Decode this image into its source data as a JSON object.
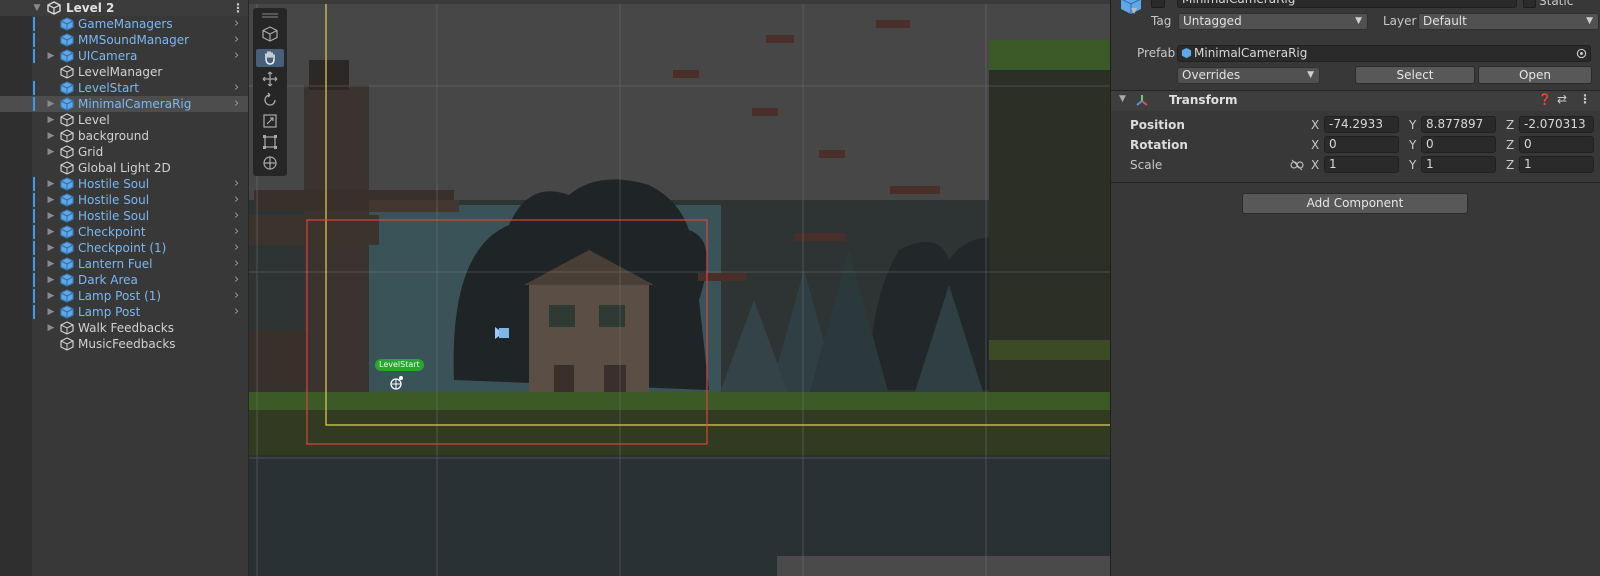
{
  "hierarchy": {
    "scene_name": "Level 2",
    "items": [
      {
        "label": "GameManagers",
        "prefab": true,
        "expandable": false,
        "chevron": true
      },
      {
        "label": "MMSoundManager",
        "prefab": true,
        "expandable": false,
        "chevron": true
      },
      {
        "label": "UICamera",
        "prefab": true,
        "expandable": true,
        "chevron": true
      },
      {
        "label": "LevelManager",
        "prefab": false,
        "expandable": false,
        "chevron": false
      },
      {
        "label": "LevelStart",
        "prefab": true,
        "expandable": false,
        "chevron": true
      },
      {
        "label": "MinimalCameraRig",
        "prefab": true,
        "expandable": true,
        "chevron": true,
        "selected": true
      },
      {
        "label": "Level",
        "prefab": false,
        "expandable": true,
        "chevron": false
      },
      {
        "label": "background",
        "prefab": false,
        "expandable": true,
        "chevron": false
      },
      {
        "label": "Grid",
        "prefab": false,
        "expandable": true,
        "chevron": false
      },
      {
        "label": "Global Light 2D",
        "prefab": false,
        "expandable": false,
        "chevron": false
      },
      {
        "label": "Hostile Soul",
        "prefab": true,
        "expandable": true,
        "chevron": true
      },
      {
        "label": "Hostile Soul",
        "prefab": true,
        "expandable": true,
        "chevron": true
      },
      {
        "label": "Hostile Soul",
        "prefab": true,
        "expandable": true,
        "chevron": true
      },
      {
        "label": "Checkpoint",
        "prefab": true,
        "expandable": true,
        "chevron": true
      },
      {
        "label": "Checkpoint (1)",
        "prefab": true,
        "expandable": true,
        "chevron": true
      },
      {
        "label": "Lantern Fuel",
        "prefab": true,
        "expandable": true,
        "chevron": true
      },
      {
        "label": "Dark Area",
        "prefab": true,
        "expandable": true,
        "chevron": true
      },
      {
        "label": "Lamp Post (1)",
        "prefab": true,
        "expandable": true,
        "chevron": true
      },
      {
        "label": "Lamp Post",
        "prefab": true,
        "expandable": true,
        "chevron": true
      },
      {
        "label": "Walk Feedbacks",
        "prefab": false,
        "expandable": true,
        "chevron": false
      },
      {
        "label": "MusicFeedbacks",
        "prefab": false,
        "expandable": false,
        "chevron": false
      }
    ]
  },
  "scene": {
    "levelstart_tag": "LevelStart"
  },
  "inspector": {
    "object_name": "MinimalCameraRig",
    "static_label": "Static",
    "tag_label": "Tag",
    "tag_value": "Untagged",
    "layer_label": "Layer",
    "layer_value": "Default",
    "prefab_label": "Prefab",
    "prefab_value": "MinimalCameraRig",
    "overrides_label": "Overrides",
    "select_button": "Select",
    "open_button": "Open",
    "transform": {
      "title": "Transform",
      "position_label": "Position",
      "rotation_label": "Rotation",
      "scale_label": "Scale",
      "position": {
        "x": "-74.2933",
        "y": "8.877897",
        "z": "-2.070313"
      },
      "rotation": {
        "x": "0",
        "y": "0",
        "z": "0"
      },
      "scale": {
        "x": "1",
        "y": "1",
        "z": "1"
      }
    },
    "axis_x": "X",
    "axis_y": "Y",
    "axis_z": "Z",
    "add_component_button": "Add Component"
  },
  "colors": {
    "prefab_text": "#7cb7f0",
    "selection": "#4d4d4d",
    "camera_bounds": "#d8463a",
    "level_bounds": "#e0d24a",
    "levelstart_badge": "#2aa531"
  }
}
